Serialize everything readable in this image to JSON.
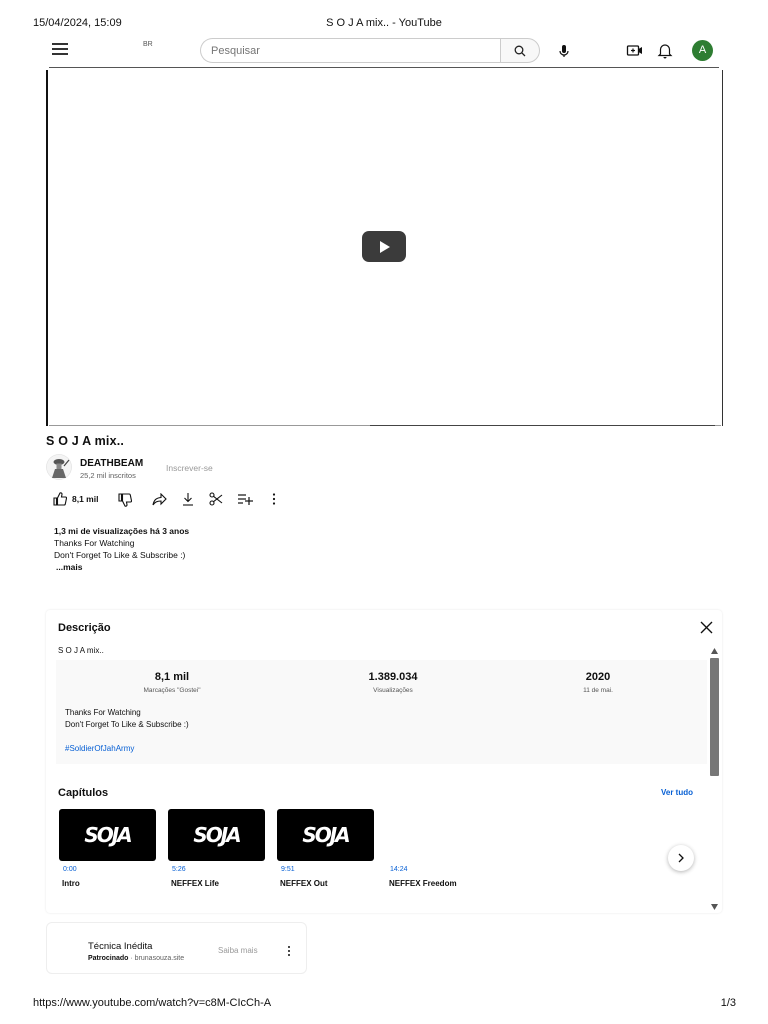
{
  "print": {
    "date": "15/04/2024, 15:09",
    "title": "S O J A mix.. - YouTube",
    "url": "https://www.youtube.com/watch?v=c8M-CIcCh-A",
    "page": "1/3"
  },
  "masthead": {
    "country": "BR",
    "search_placeholder": "Pesquisar",
    "avatar_letter": "A",
    "icons": [
      "menu-icon",
      "search-icon",
      "mic-icon",
      "create-icon",
      "bell-icon"
    ]
  },
  "video": {
    "title": "S O J A mix..",
    "channel_name": "DEATHBEAM",
    "subscribers": "25,2 mil inscritos",
    "subscribe_label": "Inscrever-se",
    "like_count": "8,1 mil",
    "views_line": "1,3 mi de visualizações  há 3 anos",
    "desc_line1": "Thanks For Watching",
    "desc_line2": "Don't Forget To Like & Subscribe :)",
    "more_label": "...mais"
  },
  "description_panel": {
    "title": "Descrição",
    "subtitle": "S O J A mix..",
    "stats": [
      {
        "value": "8,1 mil",
        "label": "Marcações \"Gostei\""
      },
      {
        "value": "1.389.034",
        "label": "Visualizações"
      },
      {
        "value": "2020",
        "label": "11 de mai."
      }
    ],
    "text1": "Thanks For Watching",
    "text2": "Don't Forget To Like & Subscribe :)",
    "hashtag": "#SoldierOfJahArmy",
    "chapters_title": "Capítulos",
    "see_all": "Ver tudo",
    "chapters": [
      {
        "time": "0:00",
        "name": "Intro",
        "thumb_text": "SOJA"
      },
      {
        "time": "5:26",
        "name": "NEFFEX Life",
        "thumb_text": "SOJA"
      },
      {
        "time": "9:51",
        "name": "NEFFEX Out",
        "thumb_text": "SOJA"
      },
      {
        "time": "14:24",
        "name": "NEFFEX Freedom",
        "thumb_text": ""
      }
    ]
  },
  "ad": {
    "title": "Técnica Inédita",
    "sponsored": "Patrocinado",
    "domain": " · brunasouza.site",
    "learn_more": "Saiba mais"
  }
}
